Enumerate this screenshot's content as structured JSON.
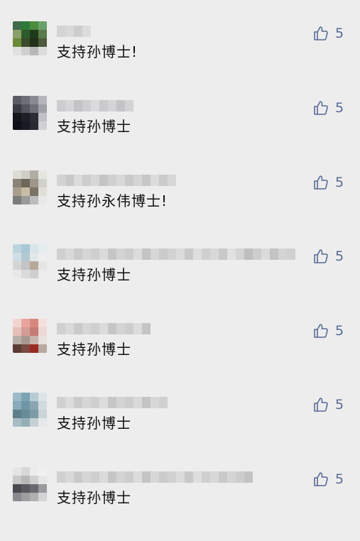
{
  "comments": [
    {
      "text": "支持孙博士!",
      "likes": "5",
      "avatar_colors": [
        "#3f6a4b",
        "#2d7a3a",
        "#4b8c3f",
        "#6aa06a",
        "#8aa06a",
        "#2d5a2a",
        "#1d3a1a",
        "#5a7a4a",
        "#6a8a3a",
        "#3a4a2a",
        "#22301a",
        "#4a5a3a",
        "#e0e0e0",
        "#cfcfcf",
        "#b8b8b8",
        "#dcdcdc"
      ],
      "nick_colors": [
        "#cfcfcf",
        "#d6d6d6",
        "#c8c8c8",
        "#dadada"
      ]
    },
    {
      "text": "支持孙博士",
      "likes": "5",
      "avatar_colors": [
        "#5a5a62",
        "#6e6e76",
        "#8a8a92",
        "#b5b5bb",
        "#3a3a44",
        "#55555f",
        "#70707a",
        "#a0a0a8",
        "#15151c",
        "#1f1f28",
        "#2c2c36",
        "#c0c0c6",
        "#101018",
        "#1a1a22",
        "#2a2a32",
        "#d0d0d4"
      ],
      "nick_colors": [
        "#c8c8cc",
        "#d2d2d6",
        "#bcbcc0",
        "#cacace",
        "#d8d8dc",
        "#c4c4c8",
        "#d0d0d4",
        "#bebec2",
        "#cfcfd3"
      ]
    },
    {
      "text": "支持孙永伟博士!",
      "likes": "5",
      "avatar_colors": [
        "#dcdcd6",
        "#cfcfc8",
        "#b0aea4",
        "#e6e6e0",
        "#8a8478",
        "#6e6658",
        "#9e968a",
        "#d2d0ca",
        "#a89e8c",
        "#c8bca4",
        "#7a7264",
        "#e0ded8",
        "#7c7c7c",
        "#9a9a9a",
        "#bcbcbc",
        "#e8e8e8"
      ],
      "nick_colors": [
        "#cfcfcf",
        "#c2c2c2",
        "#d8d8d8",
        "#c8c8c8",
        "#d4d4d4",
        "#bdbdbd",
        "#cccccc",
        "#d6d6d6",
        "#c4c4c4",
        "#d0d0d0",
        "#c0c0c0",
        "#dadada",
        "#c6c6c6",
        "#d2d2d2"
      ]
    },
    {
      "text": "支持孙博士",
      "likes": "5",
      "avatar_colors": [
        "#bcd4de",
        "#a8c8d6",
        "#d8e4ea",
        "#e6ecee",
        "#cfdde4",
        "#b4c8d2",
        "#e2e8ea",
        "#eeeeee",
        "#d4d4d4",
        "#c4c4c4",
        "#b8a898",
        "#e4e4e4",
        "#e8e8e8",
        "#dadada",
        "#cfcfcf",
        "#ececec"
      ],
      "nick_colors": [
        "#cccccc",
        "#d6d6d6",
        "#c4c4c4",
        "#d2d2d2",
        "#cacaca",
        "#d8d8d8",
        "#c0c0c0",
        "#d0d0d0",
        "#c8c8c8",
        "#dadada",
        "#bebebe",
        "#d4d4d4",
        "#c6c6c6",
        "#cecece",
        "#d8d8d8",
        "#c2c2c2",
        "#dcdcdc",
        "#cbcbcb",
        "#d5d5d5",
        "#c3c3c3",
        "#e0e0e0",
        "#d0d0d0",
        "#b8b8b8",
        "#c8c8c8",
        "#d8d8d8",
        "#bcbcbc",
        "#d0d0d0",
        "#cccccc"
      ]
    },
    {
      "text": "支持孙博士",
      "likes": "5",
      "avatar_colors": [
        "#f0d4d0",
        "#e8a49c",
        "#d88880",
        "#f4e0dc",
        "#e4c0b8",
        "#d49c94",
        "#c47c74",
        "#eed8d4",
        "#b8b0a8",
        "#a89890",
        "#c8b4ac",
        "#e8e0dc",
        "#5a3a34",
        "#7a4a40",
        "#9a2a22",
        "#b8a8a0"
      ],
      "nick_colors": [
        "#cccccc",
        "#d6d6d6",
        "#c4c4c4",
        "#d2d2d2",
        "#cacaca",
        "#d8d8d8",
        "#c0c0c0",
        "#d0d0d0",
        "#c8c8c8",
        "#dadada",
        "#bebebe"
      ]
    },
    {
      "text": "支持孙博士",
      "likes": "5",
      "avatar_colors": [
        "#9cbac8",
        "#7ea4b4",
        "#b8ccd4",
        "#dce4e8",
        "#88aab8",
        "#6e96a6",
        "#8aa6b0",
        "#d0dce0",
        "#5e7e8c",
        "#6a8c98",
        "#7e9aa4",
        "#c8d4d8",
        "#a8bcc4",
        "#94aeb8",
        "#c4d0d4",
        "#e4e8ea"
      ],
      "nick_colors": [
        "#cccccc",
        "#d8d8d8",
        "#c4c4c4",
        "#d2d2d2",
        "#cacaca",
        "#dadada",
        "#c0c0c0",
        "#d0d0d0",
        "#c8c8c8",
        "#d6d6d6",
        "#bebebe",
        "#d4d4d4",
        "#cccccc"
      ]
    },
    {
      "text": "支持孙博士",
      "likes": "5",
      "avatar_colors": [
        "#e4e4e4",
        "#d8d8d8",
        "#ececec",
        "#f0f0f0",
        "#c8c8c8",
        "#b8b8b8",
        "#d0d0d0",
        "#e6e6e6",
        "#4a4a4e",
        "#5a5a5e",
        "#6a6a6e",
        "#9a9a9e",
        "#8a8a8e",
        "#9e9e9e",
        "#b0b0b0",
        "#d4d4d4"
      ],
      "nick_colors": [
        "#cccccc",
        "#d6d6d6",
        "#c4c4c4",
        "#d2d2d2",
        "#cacaca",
        "#d8d8d8",
        "#c0c0c0",
        "#d0d0d0",
        "#c8c8c8",
        "#dadada",
        "#bebebe",
        "#d4d4d4",
        "#c6c6c6",
        "#cecece",
        "#d8d8d8",
        "#c2c2c2",
        "#dcdcdc",
        "#cbcbcb",
        "#d5d5d5",
        "#c3c3c3",
        "#d0d0d0",
        "#c8c8c8",
        "#bcbcbc"
      ]
    }
  ],
  "icons": {
    "like": "thumbs-up-icon",
    "accent_color": "#576b95"
  }
}
